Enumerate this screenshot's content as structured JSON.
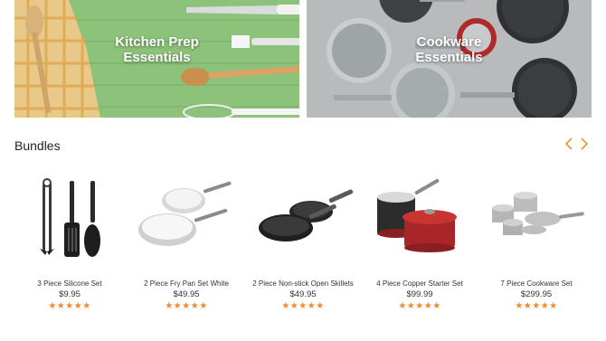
{
  "hero": {
    "left": {
      "title_line1": "Kitchen Prep",
      "title_line2": "Essentials"
    },
    "right": {
      "title_line1": "Cookware",
      "title_line2": "Essentials"
    }
  },
  "section": {
    "title": "Bundles"
  },
  "nav": {
    "prev_icon": "chevron-left-icon",
    "next_icon": "chevron-right-icon",
    "accent": "#e8942a"
  },
  "products": [
    {
      "name": "3 Piece Silicone Set",
      "price": "$9.95",
      "stars": "★★★★★",
      "rating": 5
    },
    {
      "name": "2 Piece Fry Pan Set White",
      "price": "$49.95",
      "stars": "★★★★★",
      "rating": 5
    },
    {
      "name": "2 Piece Non-stick Open Skillets",
      "price": "$49.95",
      "stars": "★★★★★",
      "rating": 5
    },
    {
      "name": "4 Piece Copper Starter Set",
      "price": "$99.99",
      "stars": "★★★★★",
      "rating": 5
    },
    {
      "name": "7 Piece Cookware Set",
      "price": "$299.95",
      "stars": "★★★★★",
      "rating": 5
    }
  ],
  "colors": {
    "star": "#f08a2c",
    "hero_left_bg": "#8fc07a",
    "hero_right_bg": "#b9bcbd"
  }
}
